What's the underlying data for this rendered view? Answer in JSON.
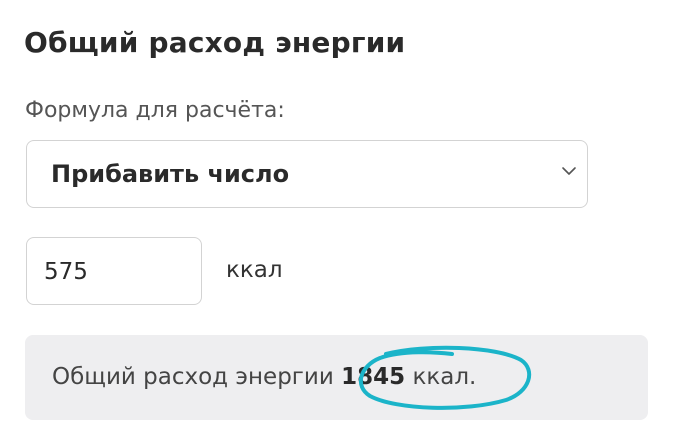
{
  "title": "Общий расход энергии",
  "formula": {
    "label": "Формула для расчёта:",
    "selected": "Прибавить число",
    "icon": "chevron-down-icon"
  },
  "addition": {
    "value": "575",
    "unit": "ккал"
  },
  "result": {
    "prefix": "Общий расход энергии",
    "value": "1845",
    "unit": "ккал."
  },
  "colors": {
    "highlight": "#1bb4c9"
  }
}
